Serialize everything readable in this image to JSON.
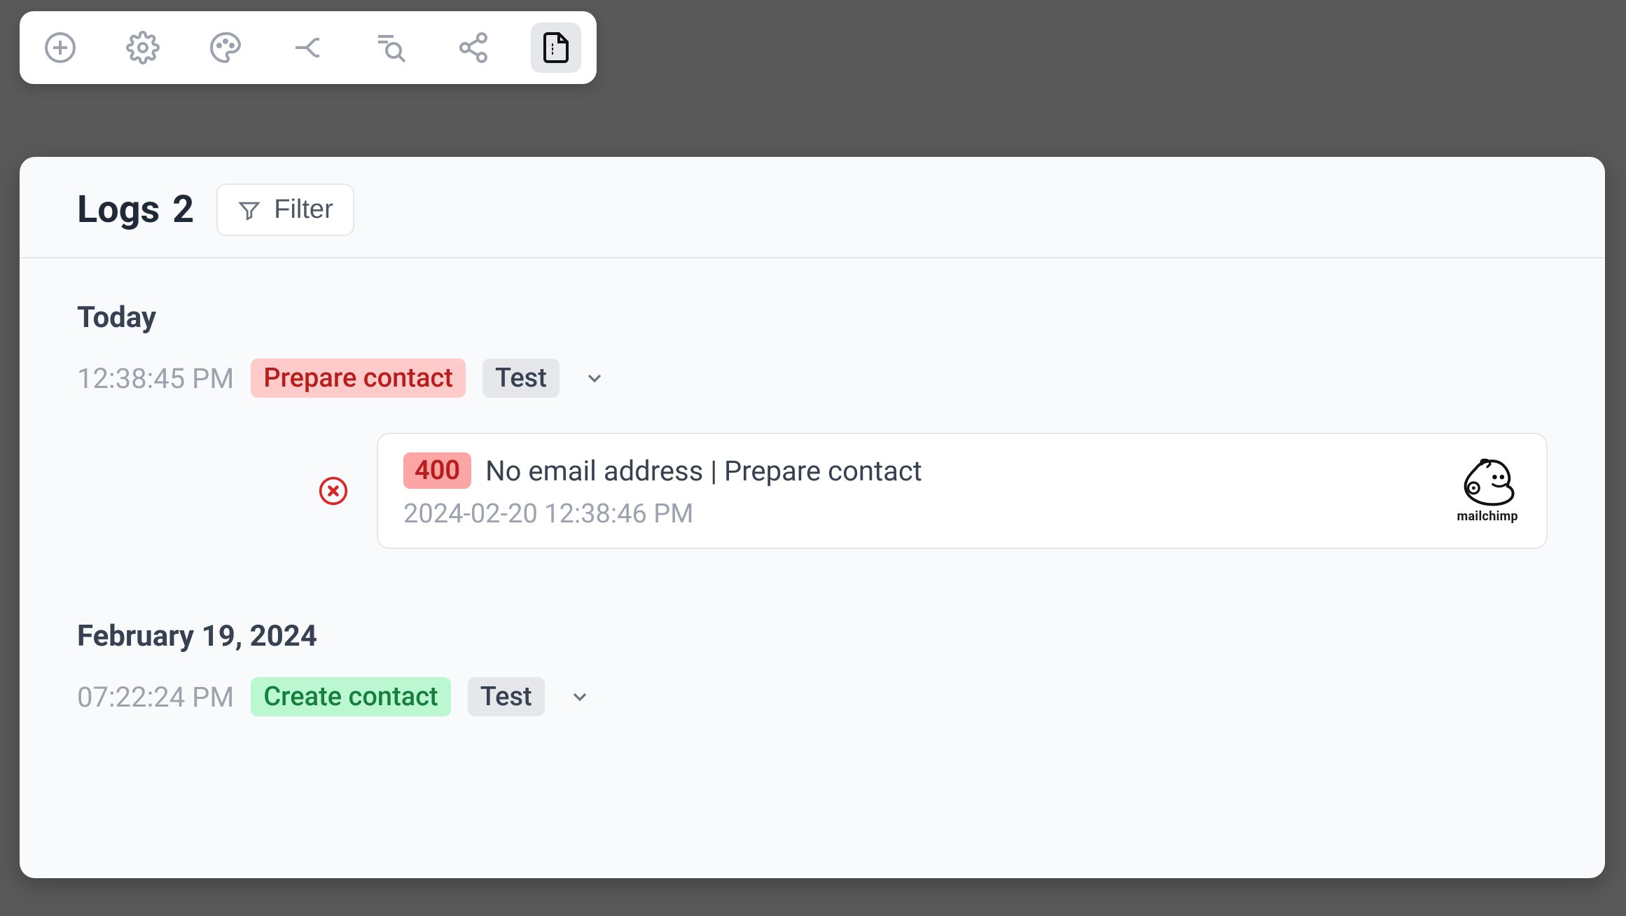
{
  "toolbar": {
    "icons": [
      {
        "name": "add-icon"
      },
      {
        "name": "gear-icon"
      },
      {
        "name": "palette-icon"
      },
      {
        "name": "split-icon"
      },
      {
        "name": "query-icon"
      },
      {
        "name": "share-icon"
      },
      {
        "name": "logs-icon"
      }
    ],
    "selected": "logs-icon"
  },
  "header": {
    "title": "Logs",
    "count": "2",
    "filter_label": "Filter"
  },
  "groups": [
    {
      "title": "Today",
      "entries": [
        {
          "time": "12:38:45 PM",
          "action": "Prepare contact",
          "action_color": "red",
          "tag": "Test",
          "detail": {
            "status": "error",
            "code": "400",
            "message": "No email address | Prepare contact",
            "timestamp": "2024-02-20 12:38:46 PM",
            "provider": "mailchimp"
          }
        }
      ]
    },
    {
      "title": "February 19, 2024",
      "entries": [
        {
          "time": "07:22:24 PM",
          "action": "Create contact",
          "action_color": "green",
          "tag": "Test"
        }
      ]
    }
  ]
}
